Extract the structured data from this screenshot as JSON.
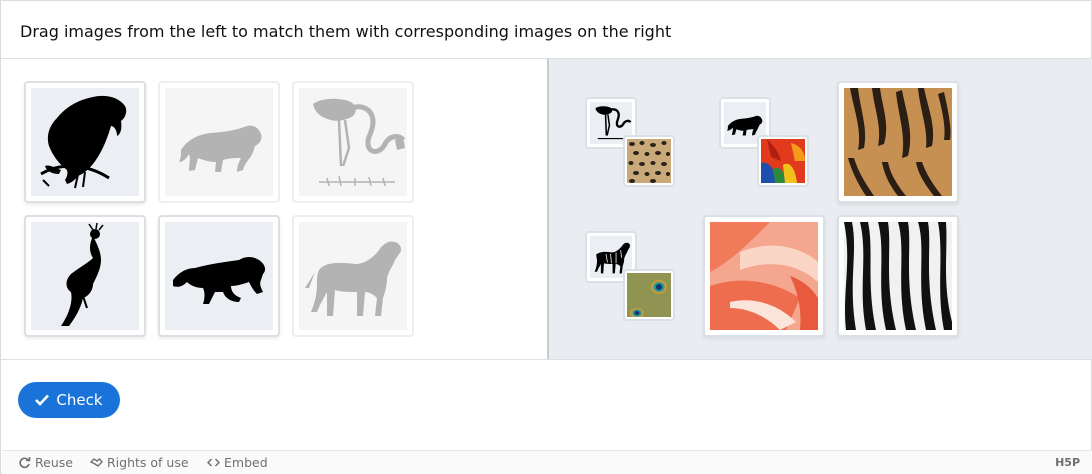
{
  "task": {
    "text": "Drag images from the left to match them with corresponding images on the right"
  },
  "draggables": [
    {
      "animal": "parrot",
      "icon": "parrot-silhouette-icon",
      "placed": false
    },
    {
      "animal": "panther",
      "icon": "panther-silhouette-icon",
      "placed": true
    },
    {
      "animal": "flamingo",
      "icon": "flamingo-silhouette-icon",
      "placed": true
    },
    {
      "animal": "peacock",
      "icon": "peacock-silhouette-icon",
      "placed": false
    },
    {
      "animal": "tiger",
      "icon": "tiger-silhouette-icon",
      "placed": false
    },
    {
      "animal": "zebra",
      "icon": "zebra-silhouette-icon",
      "placed": true
    }
  ],
  "dropzones": [
    {
      "texture": "leopard-fur",
      "matched_animal": "flamingo"
    },
    {
      "texture": "parrot-feathers",
      "matched_animal": "panther"
    },
    {
      "texture": "tiger-fur",
      "matched_animal": null
    },
    {
      "texture": "peacock-feathers",
      "matched_animal": "zebra"
    },
    {
      "texture": "flamingo-feathers",
      "matched_animal": null
    },
    {
      "texture": "zebra-stripes",
      "matched_animal": null
    }
  ],
  "actions": {
    "check_label": "Check"
  },
  "footer": {
    "reuse_label": "Reuse",
    "rights_label": "Rights of use",
    "embed_label": "Embed",
    "brand": "H5P"
  },
  "colors": {
    "accent": "#1a73d9",
    "right_pane_bg": "#e9edf1"
  }
}
